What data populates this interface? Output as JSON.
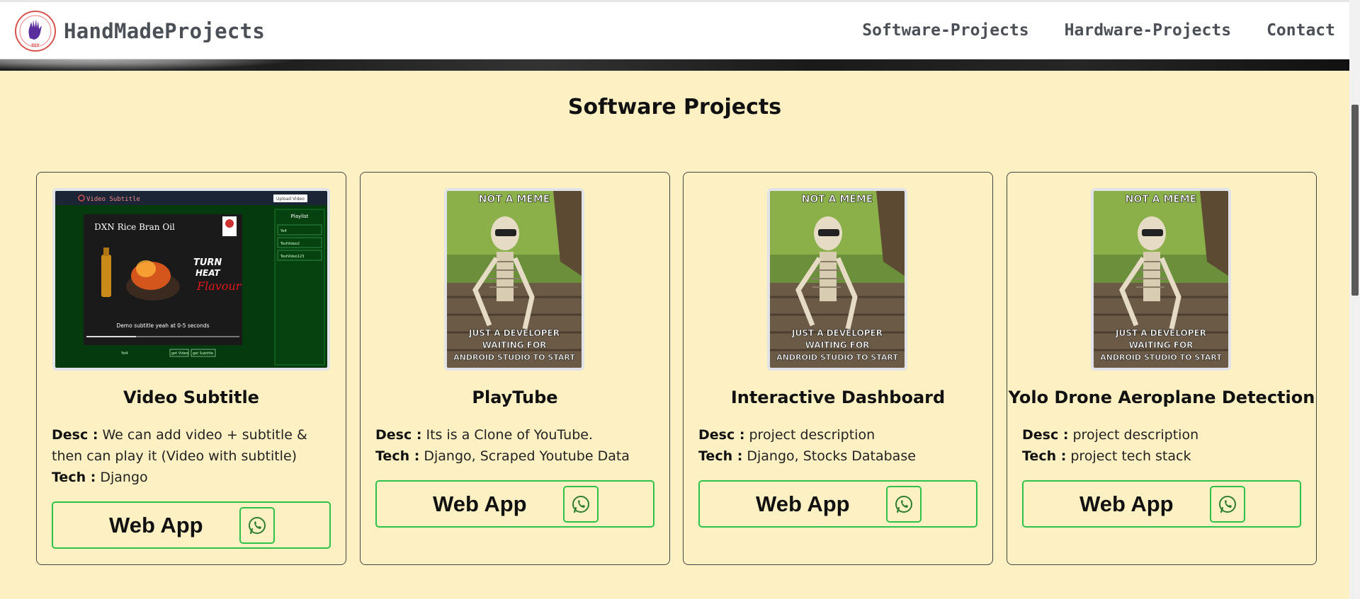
{
  "brand": {
    "name": "HandMadeProjects",
    "logo_text": "DIY"
  },
  "nav": {
    "links": [
      "Software-Projects",
      "Hardware-Projects",
      "Contact"
    ]
  },
  "section": {
    "title": "Software Projects"
  },
  "cards": [
    {
      "title": "Video Subtitle",
      "desc_label": "Desc :",
      "desc": "We can add video + subtitle & then can play it (Video with subtitle)",
      "tech_label": "Tech :",
      "tech": "Django",
      "button_label": "Web App",
      "thumb": {
        "header": "Video Subtitle",
        "upload": "Upload Video",
        "playlist": "Playlist",
        "video_title": "DXN Rice Bran Oil",
        "slogan1": "TURN",
        "slogan2": "HEAT",
        "slogan3": "Flavour",
        "caption": "Demo subtitle yeah at 0-5 seconds",
        "footer_left": "Yo4",
        "footer_btn1": "get Video",
        "footer_btn2": "get Subtitle",
        "playlist_items": [
          "Yo4",
          "TestVideo2",
          "TestVideo123"
        ]
      }
    },
    {
      "title": "PlayTube",
      "desc_label": "Desc :",
      "desc": "Its is a Clone of YouTube.",
      "tech_label": "Tech :",
      "tech": "Django, Scraped Youtube Data",
      "button_label": "Web App",
      "meme": {
        "top": "NOT A MEME",
        "bottom1": "JUST A DEVELOPER",
        "bottom2": "WAITING FOR",
        "bottom3": "ANDROID STUDIO TO START"
      }
    },
    {
      "title": "Interactive Dashboard",
      "desc_label": "Desc :",
      "desc": "project description",
      "tech_label": "Tech :",
      "tech": "Django, Stocks Database",
      "button_label": "Web App",
      "meme": {
        "top": "NOT A MEME",
        "bottom1": "JUST A DEVELOPER",
        "bottom2": "WAITING FOR",
        "bottom3": "ANDROID STUDIO TO START"
      }
    },
    {
      "title": "Yolo Drone Aeroplane Detection",
      "desc_label": "Desc :",
      "desc": "project description",
      "tech_label": "Tech :",
      "tech": "project tech stack",
      "button_label": "Web App",
      "meme": {
        "top": "NOT A MEME",
        "bottom1": "JUST A DEVELOPER",
        "bottom2": "WAITING FOR",
        "bottom3": "ANDROID STUDIO TO START"
      }
    }
  ],
  "colors": {
    "background": "#fdf1c3",
    "accent_green": "#2fc24a",
    "whatsapp": "#2e7d32",
    "brand_text": "#4b4f56"
  }
}
